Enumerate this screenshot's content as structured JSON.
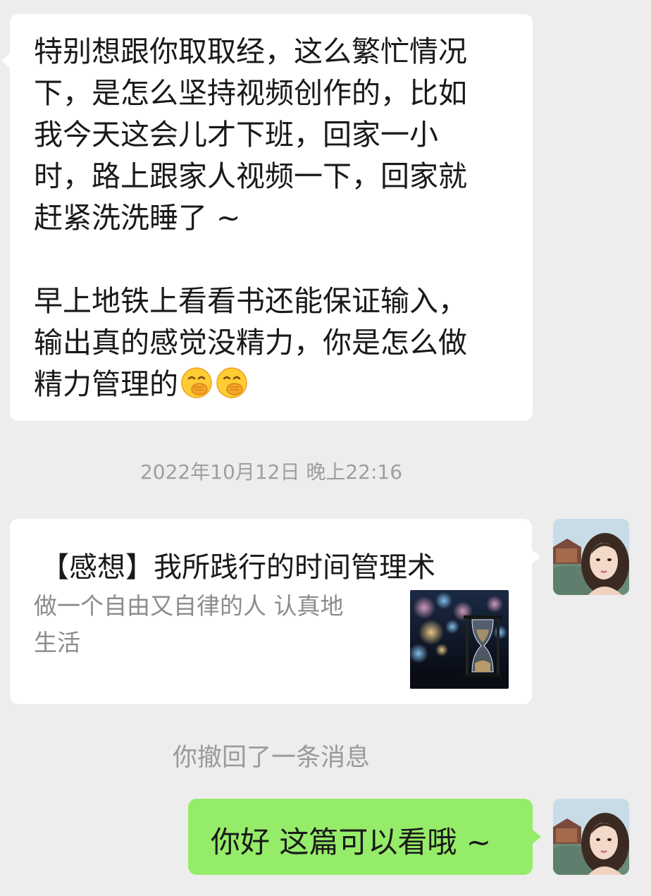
{
  "messages": {
    "incoming": {
      "paragraph1": "特别想跟你取取经，这么繁忙情况\n下，是怎么坚持视频创作的，比如\n我今天这会儿才下班，回家一小\n时，路上跟家人视频一下，回家就\n赶紧洗洗睡了 ~",
      "paragraph2": "早上地铁上看看书还能保证输入，\n输出真的感觉没精力，你是怎么做\n精力管理的",
      "emoji_name": "hand-over-mouth-emoji"
    },
    "timestamp": "2022年10月12日 晚上22:16",
    "link_card": {
      "title": "【感想】我所践行的时间管理术",
      "description": "做一个自由又自律的人 认真地\n生活",
      "thumbnail": "hourglass-city-lights-image"
    },
    "recall_notice": "你撤回了一条消息",
    "outgoing": {
      "text": "你好 这篇可以看哦 ~"
    }
  },
  "colors": {
    "chat_background": "#ededed",
    "incoming_bubble": "#ffffff",
    "outgoing_bubble": "#95ec69",
    "timestamp_text": "#9e9e9e"
  }
}
